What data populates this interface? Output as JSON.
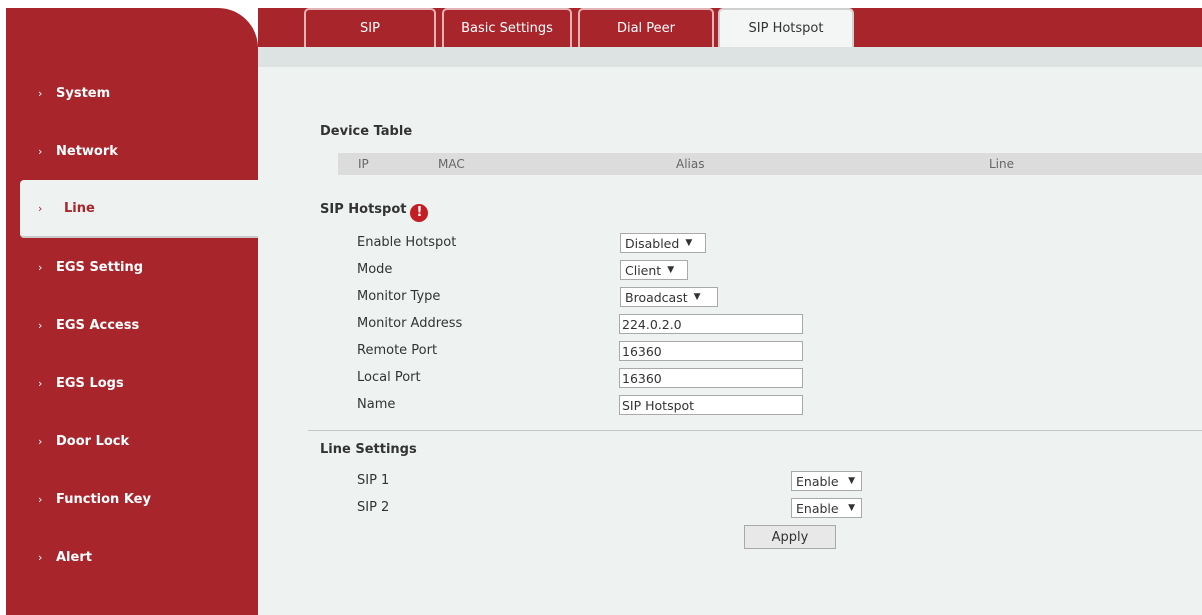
{
  "sidebar": {
    "items": [
      {
        "label": "System",
        "active": false
      },
      {
        "label": "Network",
        "active": false
      },
      {
        "label": "Line",
        "active": true
      },
      {
        "label": "EGS Setting",
        "active": false
      },
      {
        "label": "EGS Access",
        "active": false
      },
      {
        "label": "EGS Logs",
        "active": false
      },
      {
        "label": "Door Lock",
        "active": false
      },
      {
        "label": "Function Key",
        "active": false
      },
      {
        "label": "Alert",
        "active": false
      }
    ],
    "chevron": "›"
  },
  "tabs": [
    {
      "label": "SIP",
      "active": false
    },
    {
      "label": "Basic Settings",
      "active": false
    },
    {
      "label": "Dial Peer",
      "active": false
    },
    {
      "label": "SIP Hotspot",
      "active": true
    }
  ],
  "device_table": {
    "title": "Device Table",
    "columns": [
      "IP",
      "MAC",
      "Alias",
      "Line"
    ]
  },
  "sip_hotspot": {
    "title": "SIP Hotspot",
    "help_icon": "!",
    "enable_hotspot": {
      "label": "Enable Hotspot",
      "value": "Disabled"
    },
    "mode": {
      "label": "Mode",
      "value": "Client"
    },
    "monitor_type": {
      "label": "Monitor Type",
      "value": "Broadcast"
    },
    "monitor_address": {
      "label": "Monitor Address",
      "value": "224.0.2.0"
    },
    "remote_port": {
      "label": "Remote Port",
      "value": "16360"
    },
    "local_port": {
      "label": "Local Port",
      "value": "16360"
    },
    "name": {
      "label": "Name",
      "value": "SIP Hotspot"
    }
  },
  "line_settings": {
    "title": "Line Settings",
    "sip1": {
      "label": "SIP 1",
      "value": "Enable"
    },
    "sip2": {
      "label": "SIP 2",
      "value": "Enable"
    },
    "apply_label": "Apply"
  },
  "dropdown_arrow": "▼",
  "colors": {
    "brand": "#a8252c",
    "content_bg": "#eef3f2",
    "help_icon": "#c21f24"
  }
}
